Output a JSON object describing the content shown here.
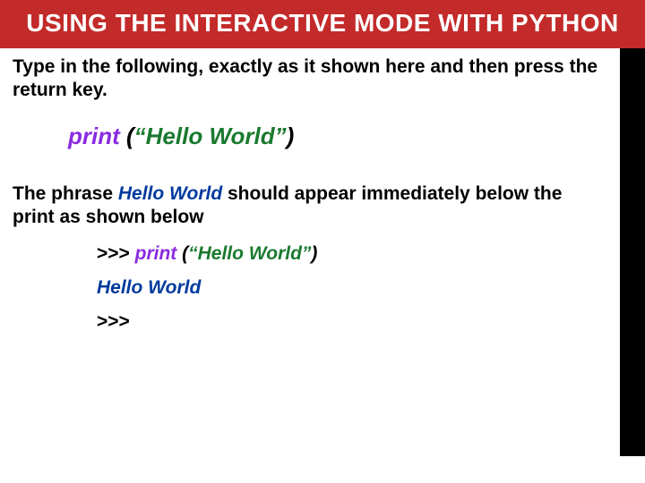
{
  "title": "USING THE INTERACTIVE MODE WITH PYTHON",
  "instruction1": "Type in the following, exactly as it shown here and then press the return key.",
  "code": {
    "keyword": "print",
    "open": " (",
    "string": "“Hello World”",
    "close": ")"
  },
  "instruction2_pre": "The phrase ",
  "instruction2_hello": "Hello World",
  "instruction2_post": " should appear immediately below the print as shown below",
  "terminal": {
    "line1_prompt": ">>> ",
    "line1_kw": "print",
    "line1_open": " (",
    "line1_str": "“Hello World”",
    "line1_close": ")",
    "line2_output": "Hello World",
    "line3_prompt": ">>>"
  }
}
